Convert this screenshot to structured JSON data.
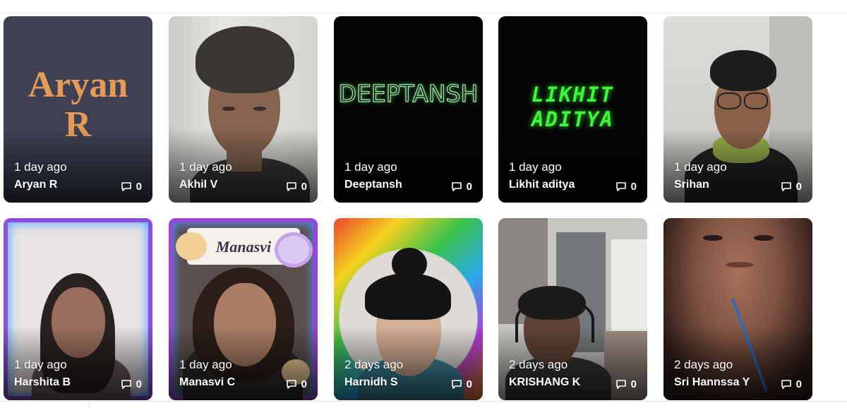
{
  "comment_icon": "comment-icon",
  "cards": [
    {
      "time": "1 day ago",
      "name": "Aryan R",
      "comments": "0",
      "thumb_text": [
        "Aryan",
        "R"
      ]
    },
    {
      "time": "1 day ago",
      "name": "Akhil V",
      "comments": "0"
    },
    {
      "time": "1 day ago",
      "name": "Deeptansh",
      "comments": "0",
      "thumb_text": [
        "DEEPTANSH"
      ]
    },
    {
      "time": "1 day ago",
      "name": "Likhit aditya",
      "comments": "0",
      "thumb_text": [
        "LIKHIT",
        "ADITYA"
      ]
    },
    {
      "time": "1 day ago",
      "name": "Srihan",
      "comments": "0"
    },
    {
      "time": "1 day ago",
      "name": "Harshita B",
      "comments": "0"
    },
    {
      "time": "1 day ago",
      "name": "Manasvi C",
      "comments": "0",
      "thumb_text": [
        "Manasvi"
      ]
    },
    {
      "time": "2 days ago",
      "name": "Harnidh S",
      "comments": "0"
    },
    {
      "time": "2 days ago",
      "name": "KRISHANG K",
      "comments": "0"
    },
    {
      "time": "2 days ago",
      "name": "Sri Hannssa Y",
      "comments": "0"
    }
  ]
}
